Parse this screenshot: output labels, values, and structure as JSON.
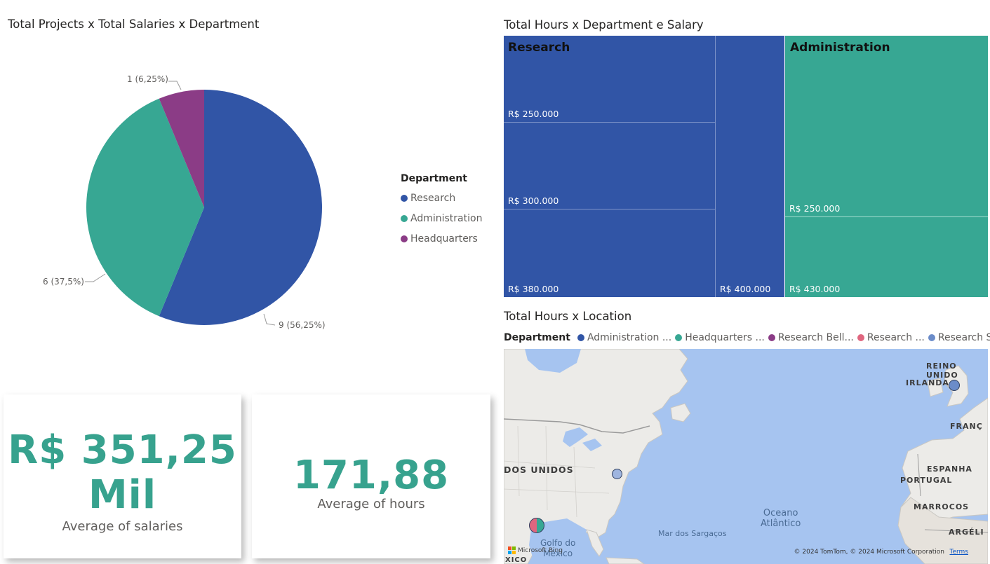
{
  "pie": {
    "title": "Total Projects x Total Salaries x Department",
    "legend_title": "Department",
    "legend": [
      {
        "label": "Research",
        "color": "#3155a6"
      },
      {
        "label": "Administration",
        "color": "#37a793"
      },
      {
        "label": "Headquarters",
        "color": "#8b3c86"
      }
    ],
    "slice_labels": {
      "headquarters": "1 (6,25%)",
      "administration": "6 (37,5%)",
      "research": "9 (56,25%)"
    }
  },
  "chart_data": [
    {
      "type": "pie",
      "title": "Total Projects x Total Salaries x Department",
      "legend_title": "Department",
      "categories": [
        "Research",
        "Administration",
        "Headquarters"
      ],
      "values": [
        9,
        6,
        1
      ],
      "percent_labels": [
        "56,25%",
        "37,5%",
        "6,25%"
      ],
      "colors": [
        "#3155a6",
        "#37a793",
        "#8b3c86"
      ],
      "legend_position": "right"
    },
    {
      "type": "treemap",
      "title": "Total Hours x Department e Salary",
      "groups": [
        {
          "name": "Research",
          "color": "#3155a6",
          "children": [
            "R$ 250.000",
            "R$ 300.000",
            "R$ 380.000",
            "R$ 400.000"
          ]
        },
        {
          "name": "Administration",
          "color": "#37a793",
          "children": [
            "R$ 250.000",
            "R$ 430.000"
          ]
        }
      ]
    }
  ],
  "cards": [
    {
      "value_line1": "R$ 351,25",
      "value_line2": "Mil",
      "label": "Average of salaries"
    },
    {
      "value": "171,88",
      "label": "Average of hours"
    }
  ],
  "treemap": {
    "title": "Total Hours x Department e Salary",
    "research_label": "Research",
    "administration_label": "Administration",
    "tiles": {
      "r250": "R$ 250.000",
      "r300": "R$ 300.000",
      "r380": "R$ 380.000",
      "r400": "R$ 400.000",
      "a250": "R$ 250.000",
      "a430": "R$ 430.000"
    },
    "colors": {
      "research": "#3155a6",
      "administration": "#37a793"
    }
  },
  "map": {
    "title": "Total Hours x Location",
    "legend_title": "Department",
    "legend": [
      {
        "label": "Administration ...",
        "color": "#3155a6"
      },
      {
        "label": "Headquarters ...",
        "color": "#37a793"
      },
      {
        "label": "Research Bell...",
        "color": "#8b3c86"
      },
      {
        "label": "Research ...",
        "color": "#e0667f"
      },
      {
        "label": "Research S...",
        "color": "#6b8cc9"
      }
    ],
    "labels": {
      "reino_unido": "REINO UNIDO",
      "irlanda": "IRLANDA",
      "franca": "FRANÇ",
      "estados_unidos": "DOS UNIDOS",
      "espanha": "ESPANHA",
      "portugal": "PORTUGAL",
      "marrocos": "MARROCOS",
      "argelia": "ARGÉLI",
      "oceano": "Oceano",
      "atlantico": "Atlântico",
      "sargacos": "Mar dos Sargaços",
      "golfo": "Golfo do",
      "mexico": "México",
      "xico": "XICO"
    },
    "attribution": "© 2024 TomTom, © 2024 Microsoft Corporation",
    "terms": "Terms",
    "provider": "Microsoft Bing"
  }
}
